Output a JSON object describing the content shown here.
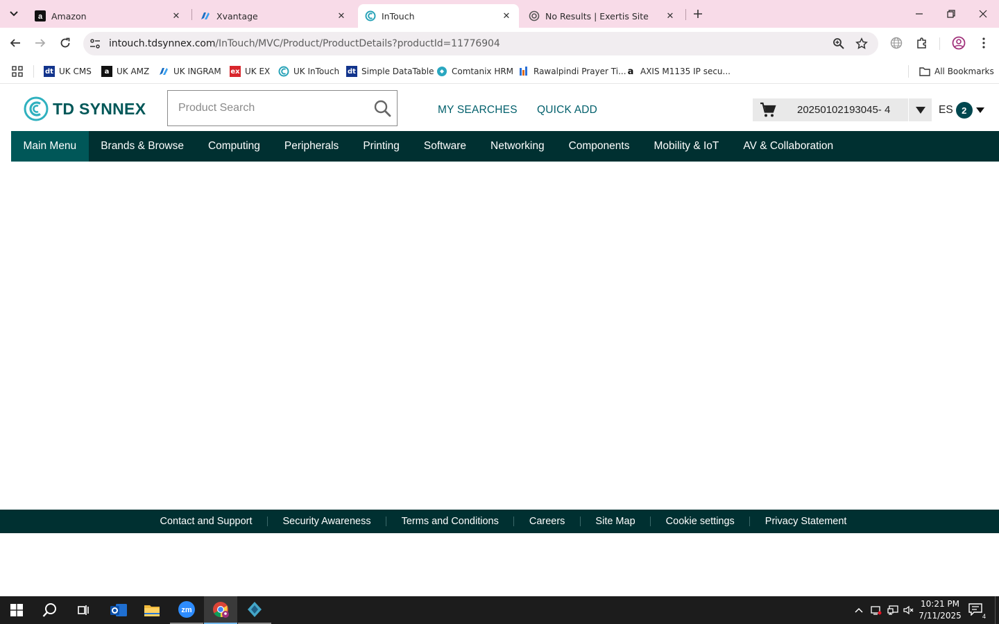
{
  "browser": {
    "tabs": [
      {
        "title": "Amazon",
        "icon": "amazon-icon",
        "active": false
      },
      {
        "title": "Xvantage",
        "icon": "xvantage-icon",
        "active": false
      },
      {
        "title": "InTouch",
        "icon": "intouch-icon",
        "active": true
      },
      {
        "title": "No Results | Exertis Site",
        "icon": "exertis-icon",
        "active": false
      }
    ],
    "url_host": "intouch.tdsynnex.com",
    "url_path": "/InTouch/MVC/Product/ProductDetails?productId=11776904",
    "bookmarks": [
      {
        "label": "UK CMS",
        "icon": "dt-icon"
      },
      {
        "label": "UK AMZ",
        "icon": "amazon-icon"
      },
      {
        "label": "UK INGRAM",
        "icon": "ingram-icon"
      },
      {
        "label": "UK EX",
        "icon": "ex-icon"
      },
      {
        "label": "UK InTouch",
        "icon": "intouch-icon"
      },
      {
        "label": "Simple DataTable",
        "icon": "dt-icon"
      },
      {
        "label": "Comtanix HRM",
        "icon": "comtanix-icon"
      },
      {
        "label": "Rawalpindi Prayer Ti...",
        "icon": "prayer-icon"
      },
      {
        "label": "AXIS M1135 IP secu...",
        "icon": "amazon-icon"
      }
    ],
    "all_bookmarks": "All Bookmarks"
  },
  "header": {
    "logo_text": "TD SYNNEX",
    "search_placeholder": "Product Search",
    "my_searches": "MY SEARCHES",
    "quick_add": "QUICK ADD",
    "cart_id": "20250102193045- 4",
    "user_initials": "ES",
    "user_badge": "2"
  },
  "nav": {
    "items": [
      {
        "label": "Main Menu",
        "active": true
      },
      {
        "label": "Brands & Browse"
      },
      {
        "label": "Computing"
      },
      {
        "label": "Peripherals"
      },
      {
        "label": "Printing"
      },
      {
        "label": "Software"
      },
      {
        "label": "Networking"
      },
      {
        "label": "Components"
      },
      {
        "label": "Mobility & IoT"
      },
      {
        "label": "AV & Collaboration"
      }
    ]
  },
  "footer": {
    "links": [
      "Contact and Support",
      "Security Awareness",
      "Terms and Conditions",
      "Careers",
      "Site Map",
      "Cookie settings",
      "Privacy Statement"
    ]
  },
  "taskbar": {
    "time": "10:21 PM",
    "date": "7/11/2025",
    "notification_count": "4"
  },
  "colors": {
    "brand_teal": "#005758",
    "nav_dark": "#003031",
    "tabbar_pink": "#f8dbe8"
  }
}
